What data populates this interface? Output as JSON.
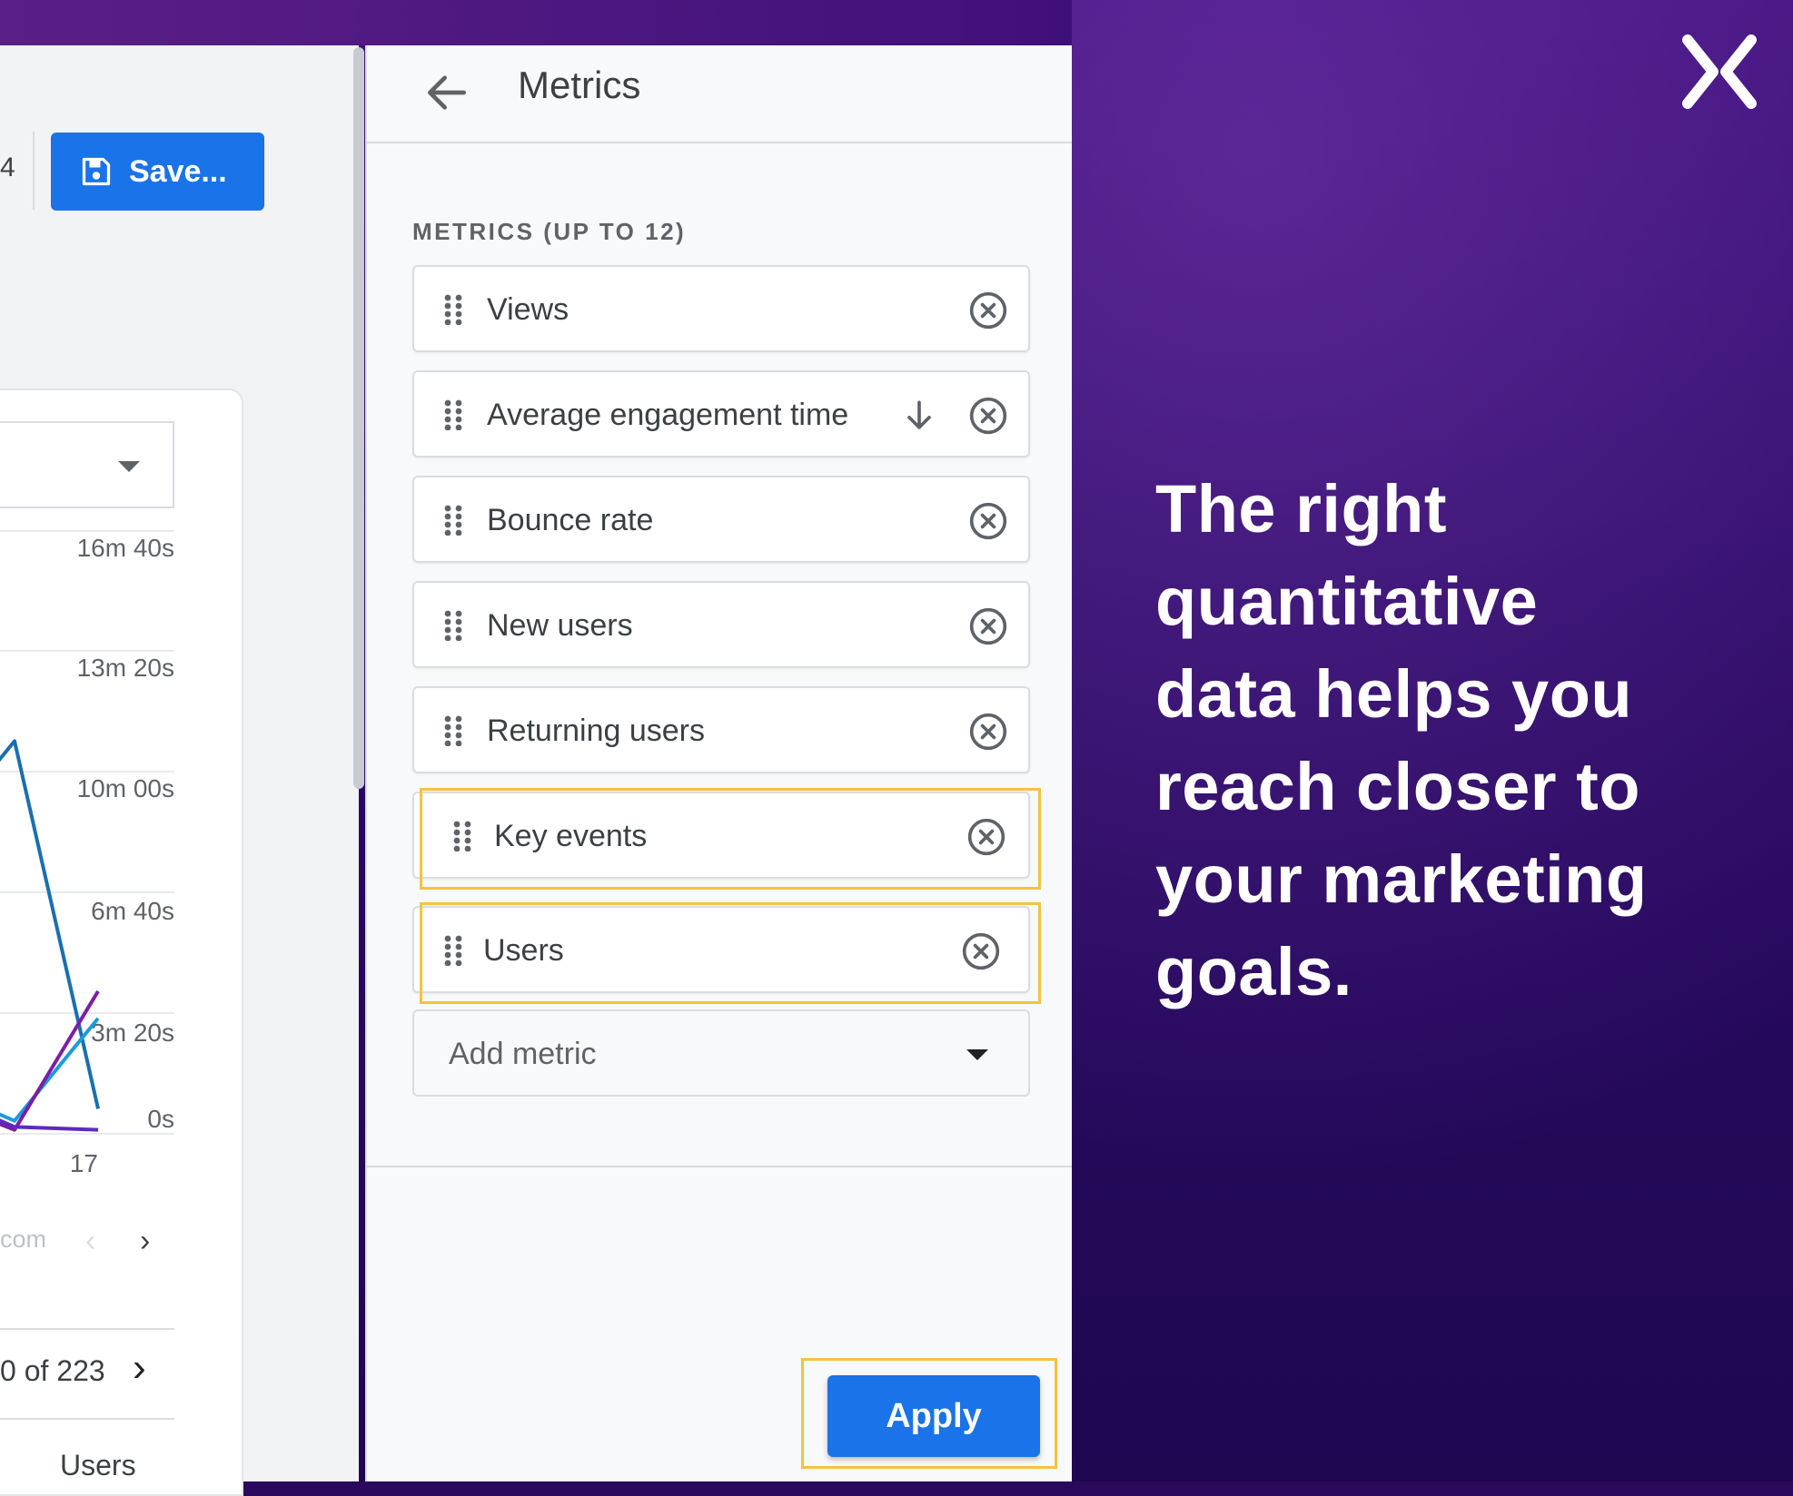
{
  "toolbar": {
    "fragment": "4",
    "save_label": "Save..."
  },
  "chart": {
    "y_ticks": [
      "16m 40s",
      "13m 20s",
      "10m 00s",
      "6m 40s",
      "3m 20s",
      "0s"
    ],
    "x_tick": "17"
  },
  "chart_data": {
    "type": "line",
    "x": [
      "",
      "17"
    ],
    "ylabel": "",
    "yticks": [
      "0s",
      "3m 20s",
      "6m 40s",
      "10m 00s",
      "13m 20s",
      "16m 40s"
    ],
    "ylim_seconds": [
      0,
      1000
    ],
    "series": [
      {
        "color": "#1a6fb0",
        "points": [
          [
            -1,
            480
          ],
          [
            0,
            650
          ],
          [
            1,
            40
          ]
        ]
      },
      {
        "color": "#1a9be0",
        "points": [
          [
            -1,
            80
          ],
          [
            0,
            20
          ],
          [
            1,
            190
          ]
        ]
      },
      {
        "color": "#7b1fa2",
        "points": [
          [
            -1,
            60
          ],
          [
            0,
            5
          ],
          [
            1,
            235
          ]
        ]
      },
      {
        "color": "#5b2bbf",
        "points": [
          [
            -1,
            70
          ],
          [
            0,
            10
          ],
          [
            1,
            5
          ]
        ]
      }
    ]
  },
  "table": {
    "pager_fragment": "com",
    "row_count": "0 of 223",
    "column_header": "Users"
  },
  "panel": {
    "title": "Metrics",
    "section_label": "METRICS (UP TO 12)",
    "metrics": [
      {
        "label": "Views"
      },
      {
        "label": "Average engagement time"
      },
      {
        "label": "Bounce rate"
      },
      {
        "label": "New users"
      },
      {
        "label": "Returning users"
      },
      {
        "label": "Key events"
      },
      {
        "label": "Users"
      }
    ],
    "add_metric_label": "Add metric",
    "apply_label": "Apply"
  },
  "promo": {
    "line1": "The right",
    "line2": "quantitative",
    "line3": "data helps you",
    "line4": "reach closer to",
    "line5": "your marketing",
    "line6": "goals."
  },
  "colors": {
    "accent_blue": "#1a73e8",
    "highlight": "#f5c242",
    "background_purple": "#2a0a5c"
  }
}
